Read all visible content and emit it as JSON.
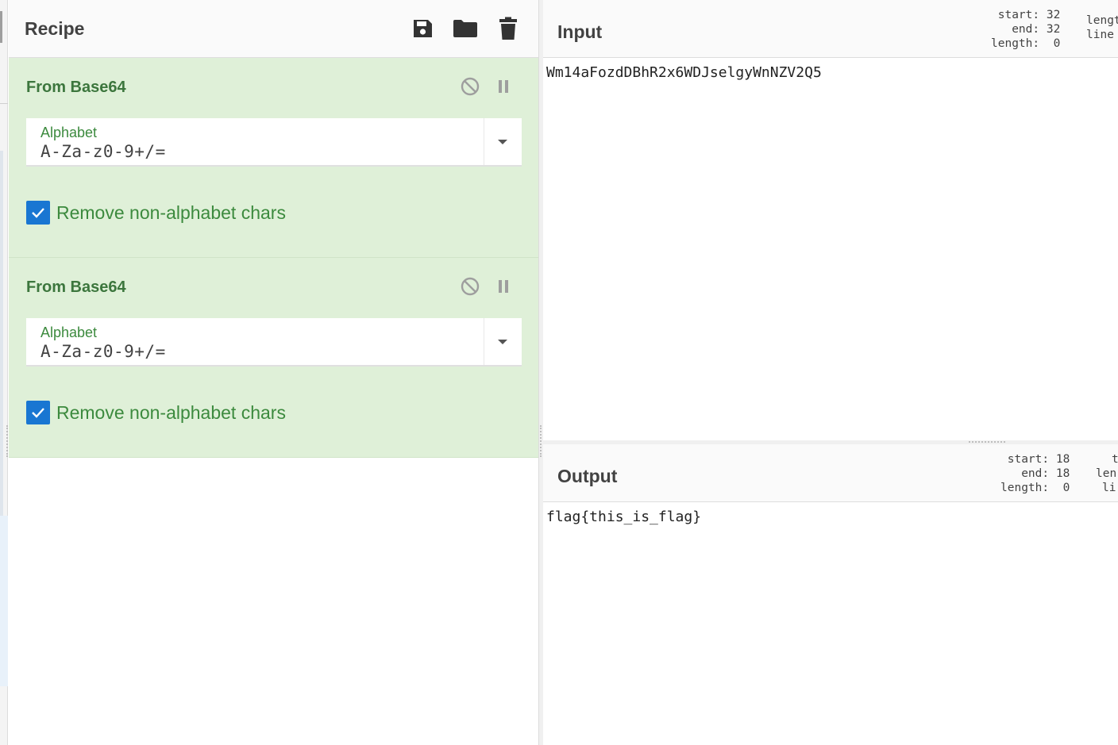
{
  "recipe": {
    "title": "Recipe",
    "tools": [
      {
        "name": "save-icon",
        "label": "Save recipe"
      },
      {
        "name": "folder-icon",
        "label": "Load recipe"
      },
      {
        "name": "trash-icon",
        "label": "Clear recipe"
      }
    ],
    "operations": [
      {
        "title": "From Base64",
        "alphabet_label": "Alphabet",
        "alphabet_value": "A-Za-z0-9+/=",
        "checkbox_label": "Remove non-alphabet chars",
        "checked": true
      },
      {
        "title": "From Base64",
        "alphabet_label": "Alphabet",
        "alphabet_value": "A-Za-z0-9+/=",
        "checkbox_label": "Remove non-alphabet chars",
        "checked": true
      }
    ]
  },
  "input": {
    "title": "Input",
    "stats_left": {
      "start": "start: 32",
      "end": "end: 32",
      "length": "length:  0"
    },
    "stats_right": {
      "line1": "lengt",
      "line2": "line"
    },
    "text": "Wm14aFozdDBhR2x6WDJselgyWnNZV2Q5"
  },
  "output": {
    "title": "Output",
    "stats_left": {
      "start": "start: 18",
      "end": "end: 18",
      "length": "length:  0"
    },
    "stats_right": {
      "line1": "t",
      "line2": "len",
      "line3": "li"
    },
    "text": "flag{this_is_flag}"
  },
  "colors": {
    "op_bg": "#dff0d8",
    "op_title": "#3c763d",
    "checkbox": "#1976d2"
  }
}
